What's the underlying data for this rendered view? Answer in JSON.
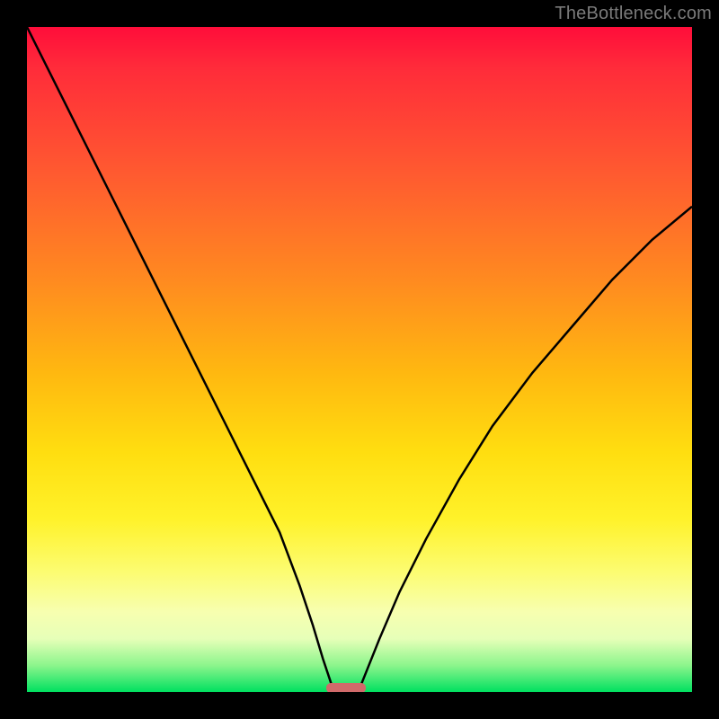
{
  "watermark": {
    "text": "TheBottleneck.com"
  },
  "chart_data": {
    "type": "line",
    "title": "",
    "xlabel": "",
    "ylabel": "",
    "xlim": [
      0,
      100
    ],
    "ylim": [
      0,
      100
    ],
    "grid": false,
    "legend": false,
    "background_gradient": {
      "direction": "vertical",
      "stops": [
        {
          "pos": 0,
          "color": "#ff0d3a"
        },
        {
          "pos": 22,
          "color": "#ff5a30"
        },
        {
          "pos": 52,
          "color": "#ffb810"
        },
        {
          "pos": 74,
          "color": "#fff22a"
        },
        {
          "pos": 92,
          "color": "#e6ffb8"
        },
        {
          "pos": 100,
          "color": "#00e060"
        }
      ]
    },
    "series": [
      {
        "name": "left-curve",
        "color": "#000000",
        "x": [
          0,
          3,
          6,
          10,
          14,
          18,
          22,
          26,
          30,
          34,
          38,
          41,
          43,
          44.5,
          45.5,
          46
        ],
        "y": [
          100,
          94,
          88,
          80,
          72,
          64,
          56,
          48,
          40,
          32,
          24,
          16,
          10,
          5,
          2,
          0.5
        ]
      },
      {
        "name": "right-curve",
        "color": "#000000",
        "x": [
          50,
          51,
          53,
          56,
          60,
          65,
          70,
          76,
          82,
          88,
          94,
          100
        ],
        "y": [
          0.5,
          3,
          8,
          15,
          23,
          32,
          40,
          48,
          55,
          62,
          68,
          73
        ]
      }
    ],
    "marker": {
      "shape": "rounded-bar",
      "color": "#d06a6a",
      "x_center": 48,
      "y_center": 0.6,
      "width": 6,
      "height": 1.4
    }
  }
}
